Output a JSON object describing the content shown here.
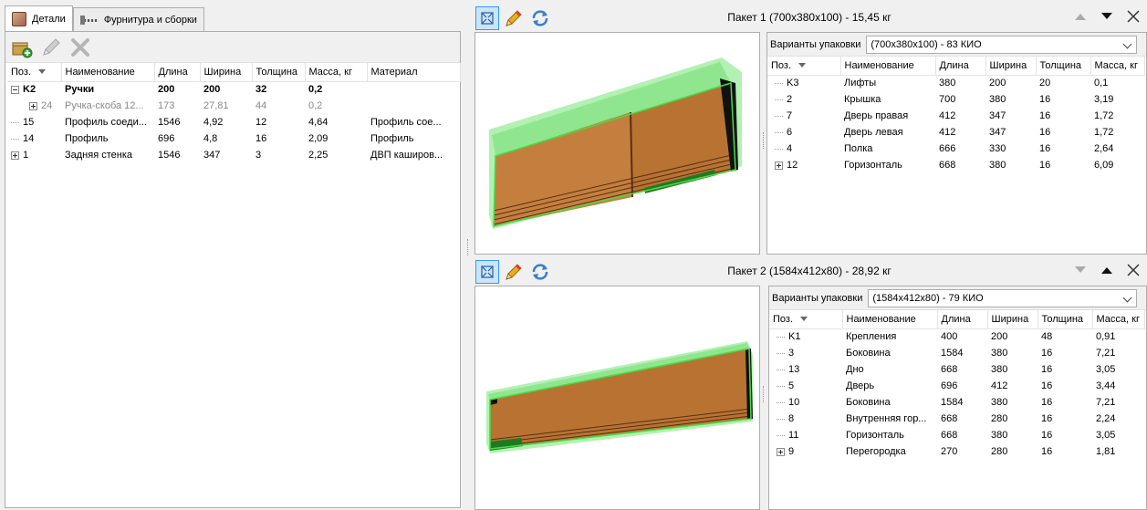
{
  "left": {
    "tabs": [
      {
        "label": "Детали",
        "icon": "wood-panel-icon"
      },
      {
        "label": "Фурнитура и сборки",
        "icon": "hardware-icon"
      }
    ],
    "toolbar": {
      "add_icon": "add-part-icon",
      "edit_icon": "pencil-icon",
      "delete_icon": "delete-icon"
    },
    "columns": [
      "Поз.",
      "Наименование",
      "Длина",
      "Ширина",
      "Толщина",
      "Масса, кг",
      "Материал"
    ],
    "rows": [
      {
        "pos": "K2",
        "name": "Ручки",
        "len": "200",
        "wid": "200",
        "thk": "32",
        "mass": "0,2",
        "mat": ""
      },
      {
        "pos": "24",
        "name": "Ручка-скоба 12...",
        "len": "173",
        "wid": "27,81",
        "thk": "44",
        "mass": "0,2",
        "mat": ""
      },
      {
        "pos": "15",
        "name": "Профиль соеди...",
        "len": "1546",
        "wid": "4,92",
        "thk": "12",
        "mass": "4,64",
        "mat": "Профиль сое..."
      },
      {
        "pos": "14",
        "name": "Профиль",
        "len": "696",
        "wid": "4,8",
        "thk": "16",
        "mass": "2,09",
        "mat": "Профиль"
      },
      {
        "pos": "1",
        "name": "Задняя стенка",
        "len": "1546",
        "wid": "347",
        "thk": "3",
        "mass": "2,25",
        "mat": "ДВП каширов..."
      }
    ]
  },
  "packages": [
    {
      "title": "Пакет 1 (700x380x100) - 15,45 кг",
      "variants_label": "Варианты упаковки",
      "variant_selected": "(700x380x100) - 83 КИО",
      "columns": [
        "Поз.",
        "Наименование",
        "Длина",
        "Ширина",
        "Толщина",
        "Масса, кг"
      ],
      "rows": [
        {
          "pos": "K3",
          "name": "Лифты",
          "len": "380",
          "wid": "200",
          "thk": "20",
          "mass": "0,1"
        },
        {
          "pos": "2",
          "name": "Крышка",
          "len": "700",
          "wid": "380",
          "thk": "16",
          "mass": "3,19"
        },
        {
          "pos": "7",
          "name": "Дверь правая",
          "len": "412",
          "wid": "347",
          "thk": "16",
          "mass": "1,72"
        },
        {
          "pos": "6",
          "name": "Дверь левая",
          "len": "412",
          "wid": "347",
          "thk": "16",
          "mass": "1,72"
        },
        {
          "pos": "4",
          "name": "Полка",
          "len": "666",
          "wid": "330",
          "thk": "16",
          "mass": "2,64"
        },
        {
          "pos": "12",
          "name": "Горизонталь",
          "len": "668",
          "wid": "380",
          "thk": "16",
          "mass": "6,09"
        }
      ]
    },
    {
      "title": "Пакет 2 (1584x412x80) - 28,92 кг",
      "variants_label": "Варианты упаковки",
      "variant_selected": "(1584x412x80) - 79 КИО",
      "columns": [
        "Поз.",
        "Наименование",
        "Длина",
        "Ширина",
        "Толщина",
        "Масса, кг"
      ],
      "rows": [
        {
          "pos": "K1",
          "name": "Крепления",
          "len": "400",
          "wid": "200",
          "thk": "48",
          "mass": "0,91"
        },
        {
          "pos": "3",
          "name": "Боковина",
          "len": "1584",
          "wid": "380",
          "thk": "16",
          "mass": "7,21"
        },
        {
          "pos": "13",
          "name": "Дно",
          "len": "668",
          "wid": "380",
          "thk": "16",
          "mass": "3,05"
        },
        {
          "pos": "5",
          "name": "Дверь",
          "len": "696",
          "wid": "412",
          "thk": "16",
          "mass": "3,44"
        },
        {
          "pos": "10",
          "name": "Боковина",
          "len": "1584",
          "wid": "380",
          "thk": "16",
          "mass": "7,21"
        },
        {
          "pos": "8",
          "name": "Внутренняя гор...",
          "len": "668",
          "wid": "280",
          "thk": "16",
          "mass": "2,24"
        },
        {
          "pos": "11",
          "name": "Горизонталь",
          "len": "668",
          "wid": "380",
          "thk": "16",
          "mass": "3,05"
        },
        {
          "pos": "9",
          "name": "Перегородка",
          "len": "270",
          "wid": "280",
          "thk": "16",
          "mass": "1,81"
        }
      ]
    }
  ],
  "colors": {
    "wood": "#b87333",
    "wood_dark": "#8b4f22",
    "highlight": "#66ff66",
    "strip": "#1f7a1f"
  }
}
